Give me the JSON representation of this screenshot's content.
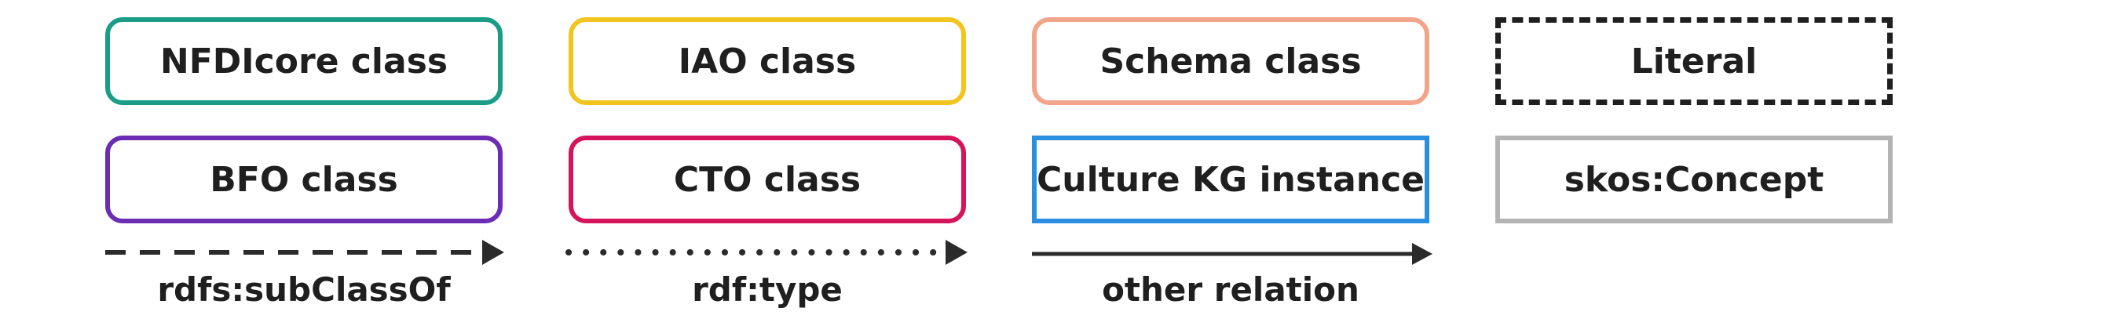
{
  "legend": {
    "nodes": [
      {
        "label": "NFDIcore class",
        "border": "#1a9c86",
        "style": "solid-rounded"
      },
      {
        "label": "IAO class",
        "border": "#f2c41f",
        "style": "solid-rounded"
      },
      {
        "label": "Schema class",
        "border": "#f2a58a",
        "style": "solid-rounded"
      },
      {
        "label": "Literal",
        "border": "#1f1f1f",
        "style": "dashed-square"
      },
      {
        "label": "BFO class",
        "border": "#6a2db4",
        "style": "solid-rounded"
      },
      {
        "label": "CTO class",
        "border": "#d6145c",
        "style": "solid-rounded"
      },
      {
        "label": "Culture KG instance",
        "border": "#2a8fe0",
        "style": "solid-square"
      },
      {
        "label": "skos:Concept",
        "border": "#b3b3b3",
        "style": "solid-square"
      }
    ],
    "edges": [
      {
        "label": "rdfs:subClassOf",
        "line": "dashed",
        "color": "#2b2b2b"
      },
      {
        "label": "rdf:type",
        "line": "dotted",
        "color": "#2b2b2b"
      },
      {
        "label": "other relation",
        "line": "solid",
        "color": "#2b2b2b"
      }
    ]
  }
}
